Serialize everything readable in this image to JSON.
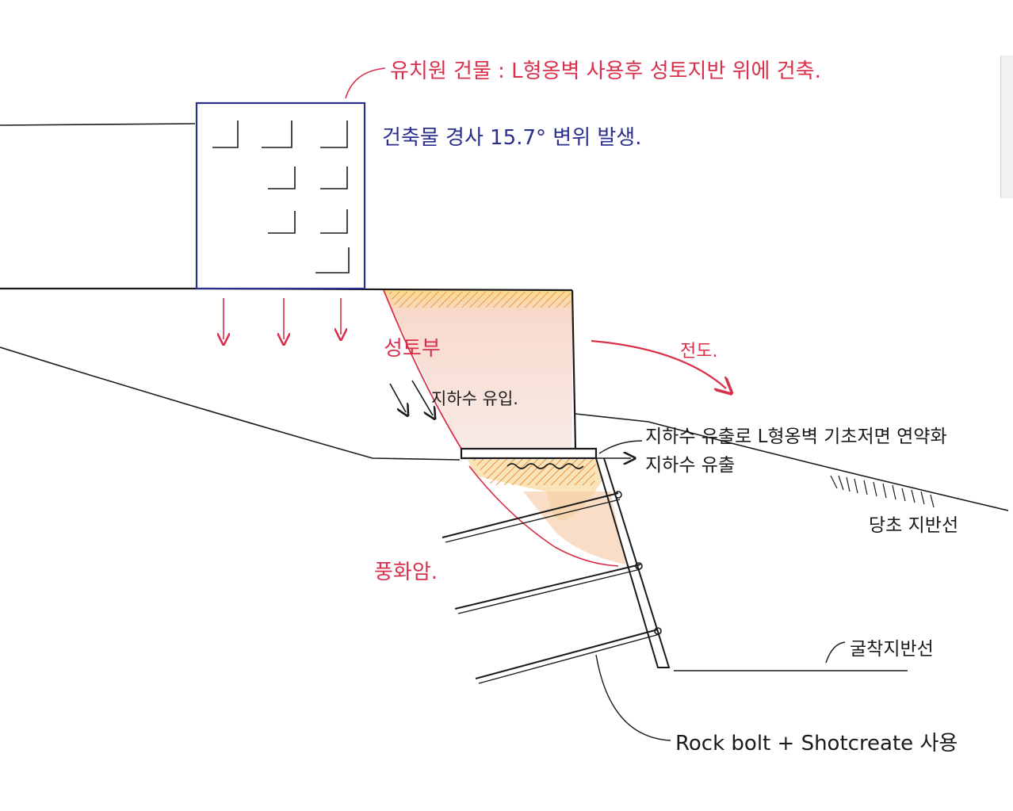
{
  "annotations": {
    "building_title": "유치원 건물 : L형옹벽 사용후 성토지반 위에 건축.",
    "building_tilt": "건축물 경사 15.7° 변위 발생.",
    "fill_zone": "성토부",
    "groundwater_inflow": "지하수 유입.",
    "rotation": "전도.",
    "groundwater_note": "지하수 유출로 L형옹벽 기초저면 연약화",
    "groundwater_outflow": "지하수 유출",
    "original_ground": "당초 지반선",
    "weathered_rock": "풍화암.",
    "excavation_line": "굴착지반선",
    "reinforcement": "Rock bolt + Shotcreate 사용"
  },
  "colors": {
    "red_ink": "#d8304a",
    "blue_ink": "#2a2f8c",
    "black_ink": "#1a1a1a",
    "fill_pink": "#f6c9b8",
    "fill_yellow": "#f7d24a",
    "hatch_orange": "#e98a2a"
  }
}
